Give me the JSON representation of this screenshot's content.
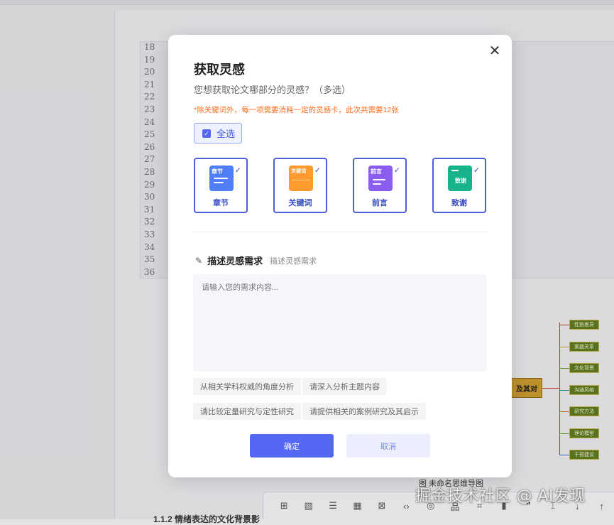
{
  "background": {
    "line_numbers": [
      "18",
      "19",
      "20",
      "21",
      "22",
      "23",
      "24",
      "25",
      "26",
      "27",
      "28",
      "29",
      "30",
      "31",
      "32",
      "33",
      "34",
      "35",
      "36"
    ],
    "mindmap": {
      "center": "及其对",
      "branches": [
        {
          "label": "性别差异",
          "color": "#c43a2e"
        },
        {
          "label": "家庭关系",
          "color": "#c99a2b"
        },
        {
          "label": "文化背景",
          "color": "#6a9a2c"
        },
        {
          "label": "沟通风格",
          "color": "#2f8f8f"
        },
        {
          "label": "研究方法",
          "color": "#c66a2a"
        },
        {
          "label": "理论模型",
          "color": "#6a9a2c"
        },
        {
          "label": "干预建议",
          "color": "#3a6ac4"
        }
      ]
    },
    "figure_caption": "图 未命名思维导图",
    "section_heading": "1.1.2 情绪表达的文化背景影",
    "toolbar_icons": [
      "plus-square-icon",
      "image-icon",
      "list-icon",
      "table-icon",
      "bracket-icon",
      "code-icon",
      "lightbulb-icon",
      "org-chart-icon",
      "frame-icon",
      "bar-chart-icon",
      "quote-icon",
      "cut-icon",
      "arrow-down-icon",
      "arrow-up-icon"
    ],
    "toolbar_glyphs": [
      "⊞",
      "▨",
      "☰",
      "▦",
      "⊠",
      "‹›",
      "◎",
      "品",
      "⌗",
      "▮",
      "❞",
      "⌶",
      "↓",
      "↑"
    ],
    "watermark": "掘金技术社区 @ AI发现"
  },
  "modal": {
    "title": "获取灵感",
    "subtitle": "您想获取论文哪部分的灵感？（多选）",
    "note": "*除关键词外，每一项需要消耗一定的灵感卡，此次共需要12张",
    "select_all": "全选",
    "cards": [
      {
        "name": "章节",
        "tag": "章节",
        "color": "#4f7ef7",
        "icon": "chapter-icon"
      },
      {
        "name": "关键词",
        "tag": "关键词",
        "color": "#ff9b2e",
        "icon": "keyword-icon"
      },
      {
        "name": "前言",
        "tag": "前言",
        "color": "#8a5cf0",
        "icon": "preface-icon"
      },
      {
        "name": "致谢",
        "tag": "致谢",
        "color": "#17b38a",
        "icon": "thanks-icon"
      }
    ],
    "describe": {
      "title": "描述灵感需求",
      "hint": "描述灵感需求",
      "placeholder": "请输入您的需求内容..."
    },
    "suggestions": [
      "从相关学科权威的角度分析",
      "请深入分析主题内容",
      "请比较定量研究与定性研究",
      "请提供相关的案例研究及其启示"
    ],
    "confirm": "确定",
    "cancel": "取消",
    "close_glyph": "✕"
  }
}
